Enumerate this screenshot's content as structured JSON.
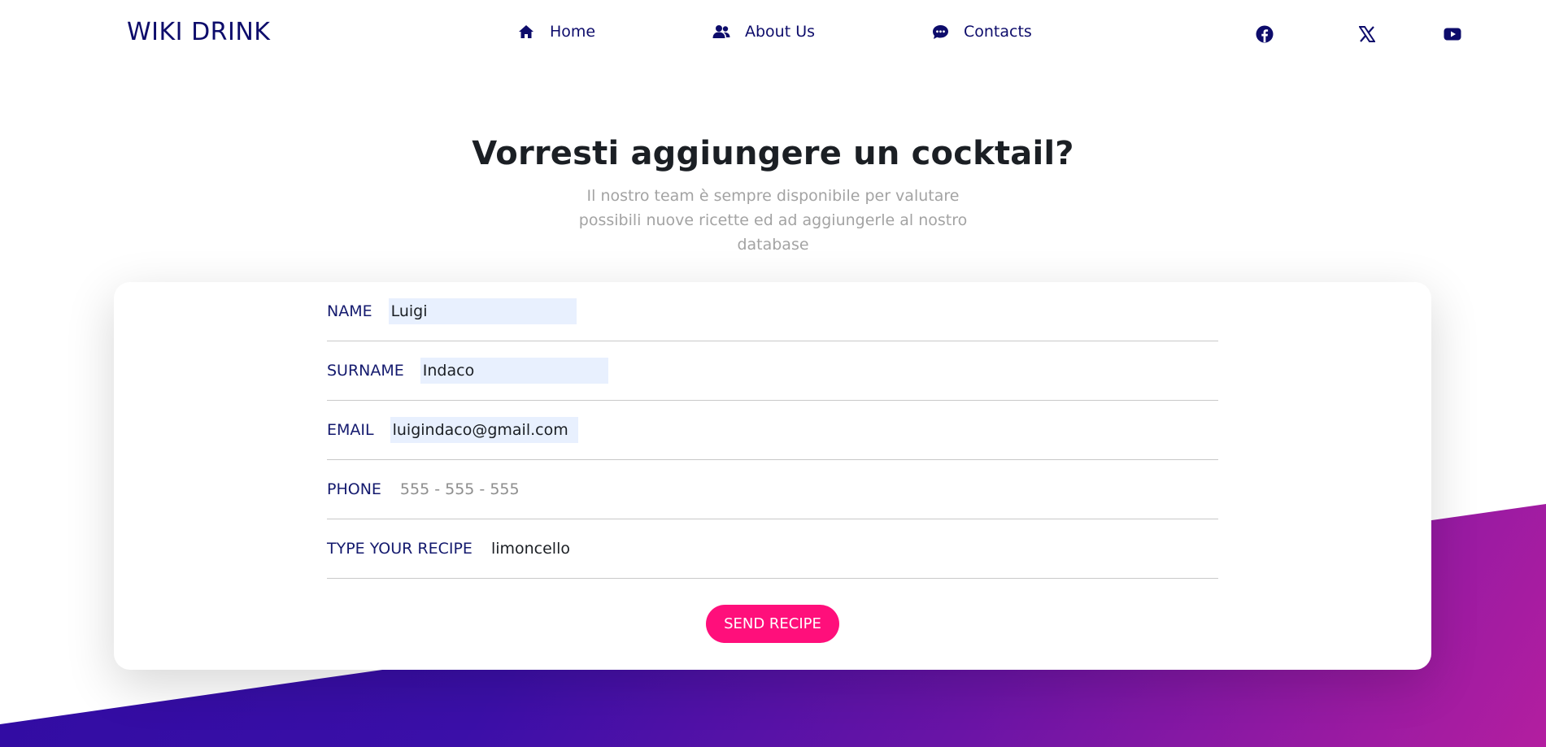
{
  "brand": "WIKI DRINK",
  "nav": {
    "home": {
      "label": "Home",
      "icon": "home-icon"
    },
    "about": {
      "label": "About Us",
      "icon": "users-icon"
    },
    "contacts": {
      "label": "Contacts",
      "icon": "chat-icon"
    }
  },
  "social": {
    "facebook": "facebook-icon",
    "x": "x-icon",
    "youtube": "youtube-icon"
  },
  "hero": {
    "title": "Vorresti aggiungere un cocktail?",
    "subtitle": "Il nostro team è sempre disponibile per valutare possibili nuove ricette ed ad aggiungerle al nostro database"
  },
  "form": {
    "name": {
      "label": "NAME",
      "value": "Luigi"
    },
    "surname": {
      "label": "SURNAME",
      "value": "Indaco"
    },
    "email": {
      "label": "EMAIL",
      "value": "luigindaco@gmail.com"
    },
    "phone": {
      "label": "PHONE",
      "placeholder": "555 - 555 - 555",
      "value": ""
    },
    "recipe": {
      "label": "TYPE YOUR RECIPE",
      "value": "limoncello"
    },
    "submit_label": "SEND RECIPE"
  },
  "colors": {
    "brand_navy": "#0d0c6b",
    "accent_pink": "#ff0f7b",
    "autofill_bg": "#e8f0fe",
    "gradient_start": "#2a0a9e",
    "gradient_end": "#b31ea0"
  }
}
